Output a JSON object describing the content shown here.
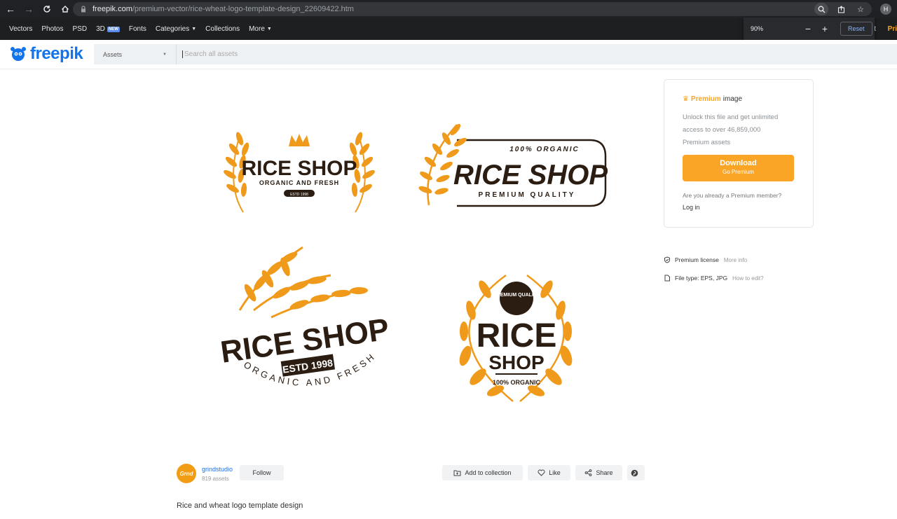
{
  "browser": {
    "url_domain": "freepik.com",
    "url_path": "/premium-vector/rice-wheat-logo-template-design_22609422.htm",
    "profile_initial": "H",
    "zoom": {
      "percent": "90%",
      "minus": "−",
      "plus": "+",
      "reset_label": "Reset"
    }
  },
  "topnav": {
    "items": [
      "Vectors",
      "Photos",
      "PSD",
      "3D",
      "Fonts",
      "Categories",
      "Collections",
      "More"
    ],
    "new_badge": "NEW",
    "right_partial": "nt",
    "right_pricing": "Pri"
  },
  "header": {
    "logo_text": "freepik",
    "asset_select": "Assets",
    "search_placeholder": "Search all assets"
  },
  "preview": {
    "logos": [
      {
        "main": "RICE SHOP",
        "sub": "ORGANIC AND FRESH",
        "tag": "ESTD 1998"
      },
      {
        "top": "100% ORGANIC",
        "main": "RICE SHOP",
        "sub": "PREMIUM QUALITY"
      },
      {
        "main": "RICE SHOP",
        "tag": "ESTD 1998",
        "arc": "ORGANIC AND FRESH"
      },
      {
        "badge": "PREMIUM QUALITY",
        "main1": "RICE",
        "main2": "SHOP",
        "sub": "100% ORGANIC"
      }
    ],
    "colors": {
      "orange": "#ef9a1b",
      "dark": "#2b1d12"
    }
  },
  "sidebar": {
    "premium_word": "Premium",
    "premium_rest": "image",
    "desc_lines": [
      "Unlock this file and get unlimited",
      "access to over 46,859,000",
      "Premium assets"
    ],
    "download_label": "Download",
    "download_sub": "Go Premium",
    "already": "Are you already a Premium member?",
    "login": "Log in",
    "license": "Premium license",
    "license_link": "More info",
    "filetype": "File type: EPS, JPG",
    "filetype_link": "How to edit?"
  },
  "author": {
    "name": "grindstudio",
    "assets": "819 assets",
    "avatar_text": "Grnd",
    "follow": "Follow"
  },
  "actions": {
    "collection": "Add to collection",
    "like": "Like",
    "share": "Share"
  },
  "title": "Rice and wheat logo template design"
}
